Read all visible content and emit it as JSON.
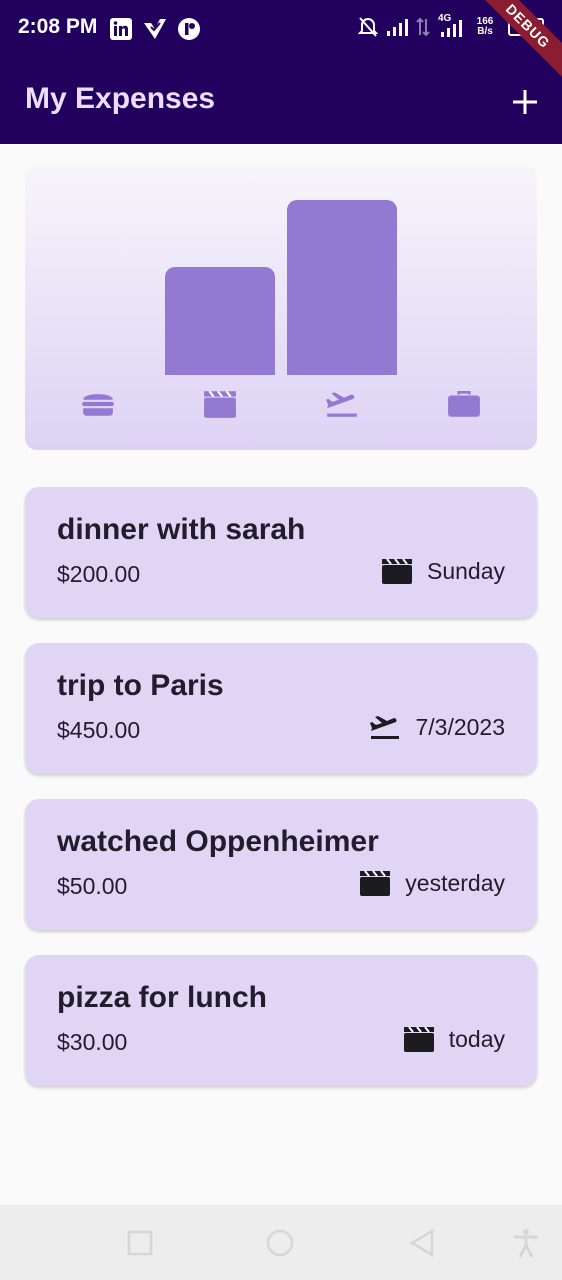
{
  "status": {
    "time": "2:08 PM",
    "network": "4G",
    "speed_value": "166",
    "speed_unit": "B/s",
    "battery": "22"
  },
  "debug_banner": "DEBUG",
  "app": {
    "title": "My Expenses",
    "add_icon": "plus-icon"
  },
  "chart": {
    "accent": "#9479d2",
    "categories": [
      {
        "name": "food",
        "icon": "burger-icon",
        "level": 0
      },
      {
        "name": "leisure",
        "icon": "clapperboard-icon",
        "level": 0.62
      },
      {
        "name": "travel",
        "icon": "airplane-takeoff-icon",
        "level": 1.0
      },
      {
        "name": "work",
        "icon": "briefcase-icon",
        "level": 0
      }
    ]
  },
  "expenses": [
    {
      "title": "dinner with sarah",
      "amount": "$200.00",
      "icon": "clapperboard-icon",
      "date": "Sunday"
    },
    {
      "title": "trip to Paris",
      "amount": "$450.00",
      "icon": "airplane-takeoff-icon",
      "date": "7/3/2023"
    },
    {
      "title": "watched Oppenheimer",
      "amount": "$50.00",
      "icon": "clapperboard-icon",
      "date": "yesterday"
    },
    {
      "title": "pizza for lunch",
      "amount": "$30.00",
      "icon": "clapperboard-icon",
      "date": "today"
    }
  ],
  "colors": {
    "app_bar": "#22005d",
    "card": "#e1d5f6",
    "title_text": "#eadfff"
  }
}
